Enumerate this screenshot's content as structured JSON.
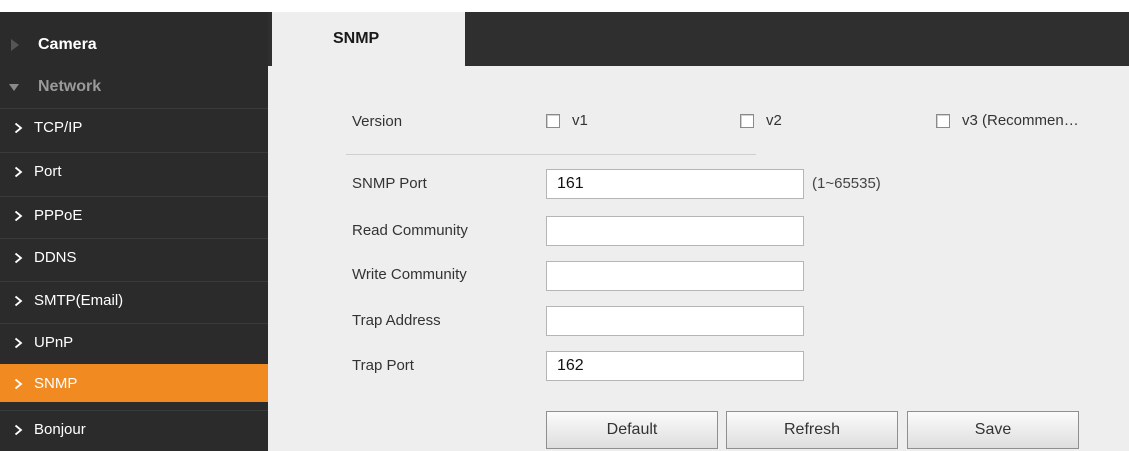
{
  "sidebar": {
    "sections": [
      {
        "label": "Camera",
        "state": "collapsed"
      },
      {
        "label": "Network",
        "state": "expanded"
      }
    ],
    "items": [
      {
        "label": "TCP/IP"
      },
      {
        "label": "Port"
      },
      {
        "label": "PPPoE"
      },
      {
        "label": "DDNS"
      },
      {
        "label": "SMTP(Email)"
      },
      {
        "label": "UPnP"
      },
      {
        "label": "SNMP",
        "active": true
      },
      {
        "label": "Bonjour"
      }
    ]
  },
  "tabs": [
    {
      "label": "SNMP",
      "active": true
    }
  ],
  "form": {
    "version": {
      "label": "Version",
      "options": [
        {
          "label": "v1",
          "checked": false
        },
        {
          "label": "v2",
          "checked": false
        },
        {
          "label": "v3 (Recommen…",
          "checked": false
        }
      ]
    },
    "snmp_port": {
      "label": "SNMP Port",
      "value": "161",
      "hint": "(1~65535)"
    },
    "read_community": {
      "label": "Read Community",
      "value": ""
    },
    "write_community": {
      "label": "Write Community",
      "value": ""
    },
    "trap_address": {
      "label": "Trap Address",
      "value": ""
    },
    "trap_port": {
      "label": "Trap Port",
      "value": "162"
    }
  },
  "buttons": {
    "default": "Default",
    "refresh": "Refresh",
    "save": "Save"
  },
  "colors": {
    "accent": "#f28a22",
    "sidebar_bg": "#2b2b2b",
    "content_bg": "#eeeeee"
  }
}
